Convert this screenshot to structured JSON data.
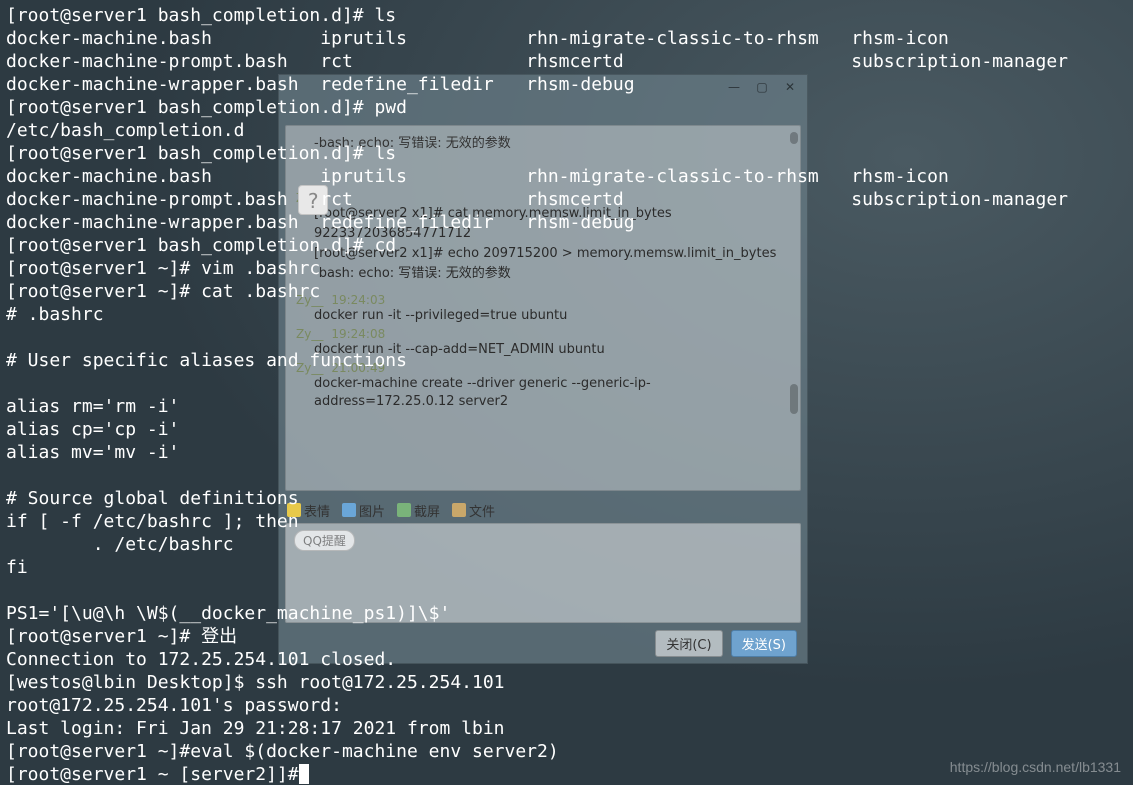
{
  "terminal": {
    "lines": [
      "[root@server1 bash_completion.d]# ls",
      "docker-machine.bash          iprutils           rhn-migrate-classic-to-rhsm   rhsm-icon",
      "docker-machine-prompt.bash   rct                rhsmcertd                     subscription-manager",
      "docker-machine-wrapper.bash  redefine_filedir   rhsm-debug",
      "[root@server1 bash_completion.d]# pwd",
      "/etc/bash_completion.d",
      "[root@server1 bash_completion.d]# ls",
      "docker-machine.bash          iprutils           rhn-migrate-classic-to-rhsm   rhsm-icon",
      "docker-machine-prompt.bash   rct                rhsmcertd                     subscription-manager",
      "docker-machine-wrapper.bash  redefine_filedir   rhsm-debug",
      "[root@server1 bash_completion.d]# cd",
      "[root@server1 ~]# vim .bashrc",
      "[root@server1 ~]# cat .bashrc",
      "# .bashrc",
      "",
      "# User specific aliases and functions",
      "",
      "alias rm='rm -i'",
      "alias cp='cp -i'",
      "alias mv='mv -i'",
      "",
      "# Source global definitions",
      "if [ -f /etc/bashrc ]; then",
      "        . /etc/bashrc",
      "fi",
      "",
      "PS1='[\\u@\\h \\W$(__docker_machine_ps1)]\\$'",
      "[root@server1 ~]# 登出",
      "Connection to 172.25.254.101 closed.",
      "[westos@lbin Desktop]$ ssh root@172.25.254.101",
      "root@172.25.254.101's password:",
      "Last login: Fri Jan 29 21:28:17 2021 from lbin",
      "[root@server1 ~]#eval $(docker-machine env server2)",
      "[root@server1 ~ [server2]]#"
    ]
  },
  "chat": {
    "window_controls": {
      "min": "—",
      "max": "▢",
      "close": "✕"
    },
    "avatar_q": "?",
    "body_top_sys": "-bash: echo: 写错误: 无效的参数",
    "messages": [
      {
        "name": "Zy__",
        "time": "",
        "text": "[root@server2 x1]# cat memory.memsw.limit_in_bytes"
      },
      {
        "name": "",
        "time": "",
        "text": "9223372036854771712"
      },
      {
        "name": "",
        "time": "",
        "text": "[root@server2 x1]# echo 209715200 > memory.memsw.limit_in_bytes"
      },
      {
        "name": "",
        "time": "",
        "text": "-bash: echo: 写错误: 无效的参数"
      },
      {
        "name": "Zy__",
        "time": "19:24:03",
        "text": "docker run -it --privileged=true  ubuntu"
      },
      {
        "name": "Zy__",
        "time": "19:24:08",
        "text": "docker run -it --cap-add=NET_ADMIN  ubuntu"
      },
      {
        "name": "Zy__",
        "time": "21:00:49",
        "text": "docker-machine create --driver generic --generic-ip-address=172.25.0.12 server2"
      }
    ],
    "toolbar": {
      "face": "表情",
      "image": "图片",
      "shot": "截屏",
      "file": "文件"
    },
    "hint": "QQ提醒",
    "close_btn": "关闭(C)",
    "send_btn": "发送(S)"
  },
  "watermark": "https://blog.csdn.net/lb1331"
}
